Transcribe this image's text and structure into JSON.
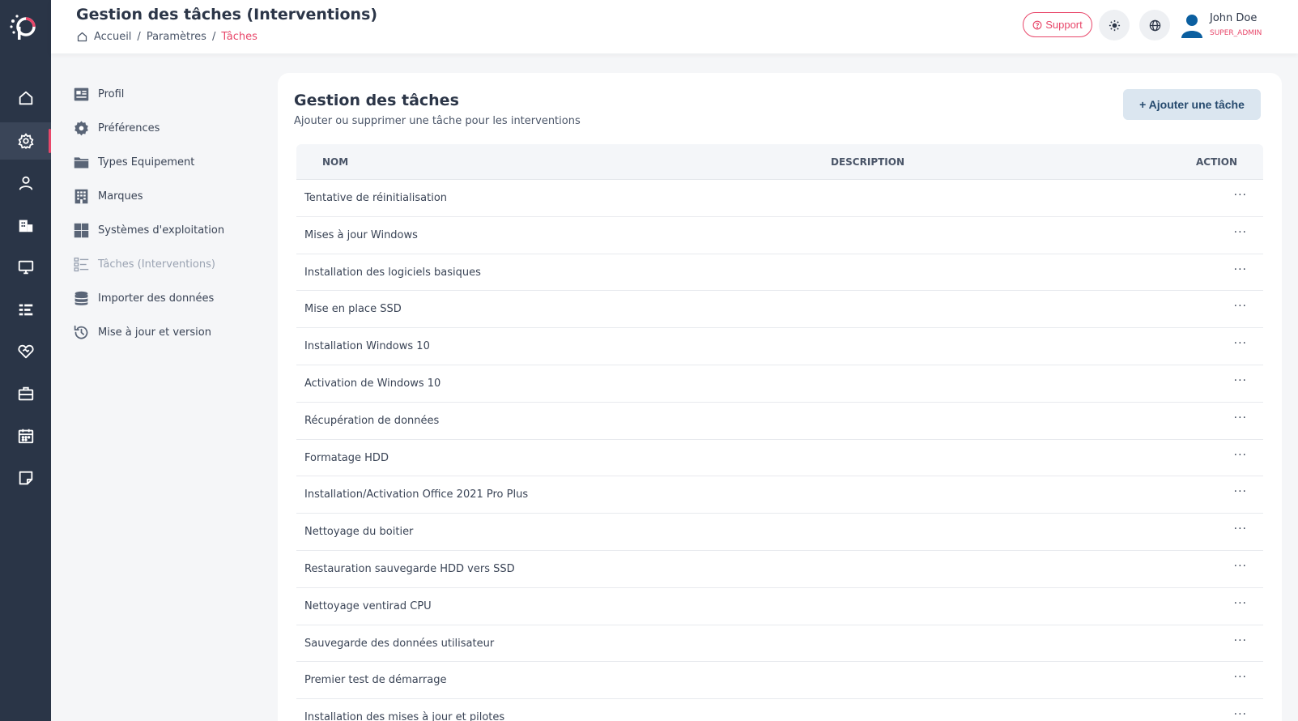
{
  "header": {
    "title": "Gestion des tâches (Interventions)",
    "breadcrumb": [
      "Accueil",
      "Paramètres",
      "Tâches"
    ],
    "support_label": "Support",
    "user_name": "John Doe",
    "user_role": "SUPER_ADMIN"
  },
  "rail": {
    "icons": [
      "home-icon",
      "gear-icon",
      "user-icon",
      "building-icon",
      "monitor-icon",
      "task-list-icon",
      "heart-handshake-icon",
      "briefcase-icon",
      "calendar-icon",
      "note-icon"
    ],
    "active_index": 1
  },
  "settings_menu": {
    "items": [
      {
        "label": "Profil",
        "icon": "profile-card-icon"
      },
      {
        "label": "Préférences",
        "icon": "gear-icon"
      },
      {
        "label": "Types Equipement",
        "icon": "folder-icon"
      },
      {
        "label": "Marques",
        "icon": "building-icon"
      },
      {
        "label": "Systèmes d'exploitation",
        "icon": "windows-icon"
      },
      {
        "label": "Tâches (Interventions)",
        "icon": "task-list-icon"
      },
      {
        "label": "Importer des données",
        "icon": "database-icon"
      },
      {
        "label": "Mise à jour et version",
        "icon": "history-icon"
      }
    ],
    "active_index": 5
  },
  "main": {
    "title": "Gestion des tâches",
    "subtitle": "Ajouter ou supprimer une tâche pour les interventions",
    "add_button": "+ Ajouter une tâche",
    "table": {
      "columns": [
        "NOM",
        "DESCRIPTION",
        "ACTION"
      ],
      "action_glyph": "···",
      "rows": [
        "Tentative de réinitialisation",
        "Mises à jour Windows",
        "Installation des logiciels basiques",
        "Mise en place SSD",
        "Installation Windows 10",
        "Activation de Windows 10",
        "Récupération de données",
        "Formatage HDD",
        "Installation/Activation Office 2021 Pro Plus",
        "Nettoyage du boitier",
        "Restauration sauvegarde HDD vers SSD",
        "Nettoyage ventirad CPU",
        "Sauvegarde des données utilisateur",
        "Premier test de démarrage",
        "Installation des mises à jour et pilotes"
      ]
    }
  },
  "colors": {
    "accent": "#e8476a",
    "rail_bg": "#2a3547",
    "add_button_bg": "#dbe6f0"
  }
}
